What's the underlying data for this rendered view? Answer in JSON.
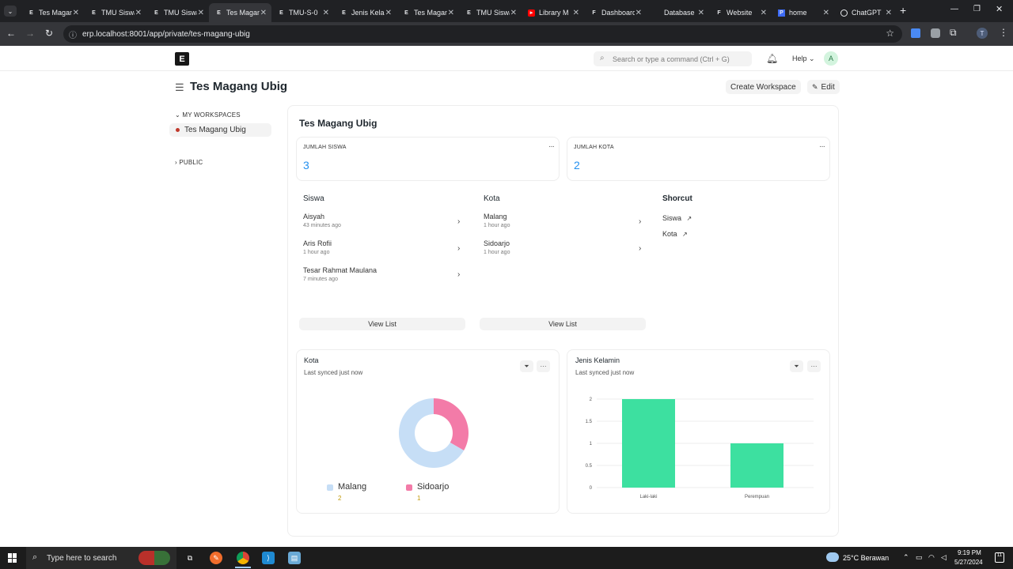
{
  "browser": {
    "tabs": [
      {
        "title": "Tes Magang Ubig",
        "icon": "E",
        "active": false
      },
      {
        "title": "TMU Siswa",
        "icon": "E",
        "active": false
      },
      {
        "title": "TMU Siswa",
        "icon": "E",
        "active": false
      },
      {
        "title": "Tes Magang Ubig",
        "icon": "E",
        "active": true
      },
      {
        "title": "TMU-S-0",
        "icon": "E",
        "active": false
      },
      {
        "title": "Jenis Kelamin",
        "icon": "E",
        "active": false
      },
      {
        "title": "Tes Magang Ubig",
        "icon": "E",
        "active": false
      },
      {
        "title": "TMU Siswa",
        "icon": "E",
        "active": false
      },
      {
        "title": "Library M",
        "icon": "yt",
        "active": false
      },
      {
        "title": "Dashboard",
        "icon": "F",
        "active": false
      },
      {
        "title": "Database",
        "icon": "",
        "active": false
      },
      {
        "title": "Website",
        "icon": "F",
        "active": false
      },
      {
        "title": "home",
        "icon": "P",
        "active": false
      },
      {
        "title": "ChatGPT",
        "icon": "gpt",
        "active": false
      }
    ],
    "url": "erp.localhost:8001/app/private/tes-magang-ubig",
    "new_tab": "+",
    "profile_initial": "T"
  },
  "navbar": {
    "logo": "E",
    "search_placeholder": "Search or type a command (Ctrl + G)",
    "help_label": "Help",
    "avatar_initial": "A"
  },
  "header": {
    "title": "Tes Magang Ubig",
    "create_workspace": "Create Workspace",
    "edit": "Edit"
  },
  "sidebar": {
    "my_workspaces": "MY WORKSPACES",
    "active_item": "Tes Magang Ubig",
    "public": "PUBLIC"
  },
  "workspace": {
    "title": "Tes Magang Ubig",
    "number_cards": [
      {
        "label": "JUMLAH SISWA",
        "value": "3"
      },
      {
        "label": "JUMLAH KOTA",
        "value": "2"
      }
    ],
    "siswa": {
      "heading": "Siswa",
      "items": [
        {
          "name": "Aisyah",
          "time": "43 minutes ago"
        },
        {
          "name": "Aris Rofii",
          "time": "1 hour ago"
        },
        {
          "name": "Tesar Rahmat Maulana",
          "time": "7 minutes ago"
        }
      ],
      "view_list": "View List"
    },
    "kota": {
      "heading": "Kota",
      "items": [
        {
          "name": "Malang",
          "time": "1 hour ago"
        },
        {
          "name": "Sidoarjo",
          "time": "1 hour ago"
        }
      ],
      "view_list": "View List"
    },
    "shortcut": {
      "heading": "Shorcut",
      "items": [
        "Siswa",
        "Kota"
      ]
    },
    "donut_card": {
      "title": "Kota",
      "subtitle": "Last synced just now",
      "legend": [
        {
          "label": "Malang",
          "value": "2"
        },
        {
          "label": "Sidoarjo",
          "value": "1"
        }
      ]
    },
    "bar_card": {
      "title": "Jenis Kelamin",
      "subtitle": "Last synced just now"
    }
  },
  "chart_data": [
    {
      "type": "pie",
      "title": "Kota",
      "categories": [
        "Malang",
        "Sidoarjo"
      ],
      "values": [
        2,
        1
      ],
      "colors": [
        "#c6def6",
        "#f37ba8"
      ]
    },
    {
      "type": "bar",
      "title": "Jenis Kelamin",
      "categories": [
        "Laki-laki",
        "Perempuan"
      ],
      "values": [
        2,
        1
      ],
      "ylim": [
        0,
        2
      ],
      "yticks": [
        "0",
        "0.5",
        "1",
        "1.5",
        "2"
      ],
      "color": "#3de0a0",
      "grid": true
    }
  ],
  "taskbar": {
    "search_placeholder": "Type here to search",
    "weather": "25°C  Berawan",
    "time": "9:19 PM",
    "date": "5/27/2024",
    "notif_count": "11"
  }
}
